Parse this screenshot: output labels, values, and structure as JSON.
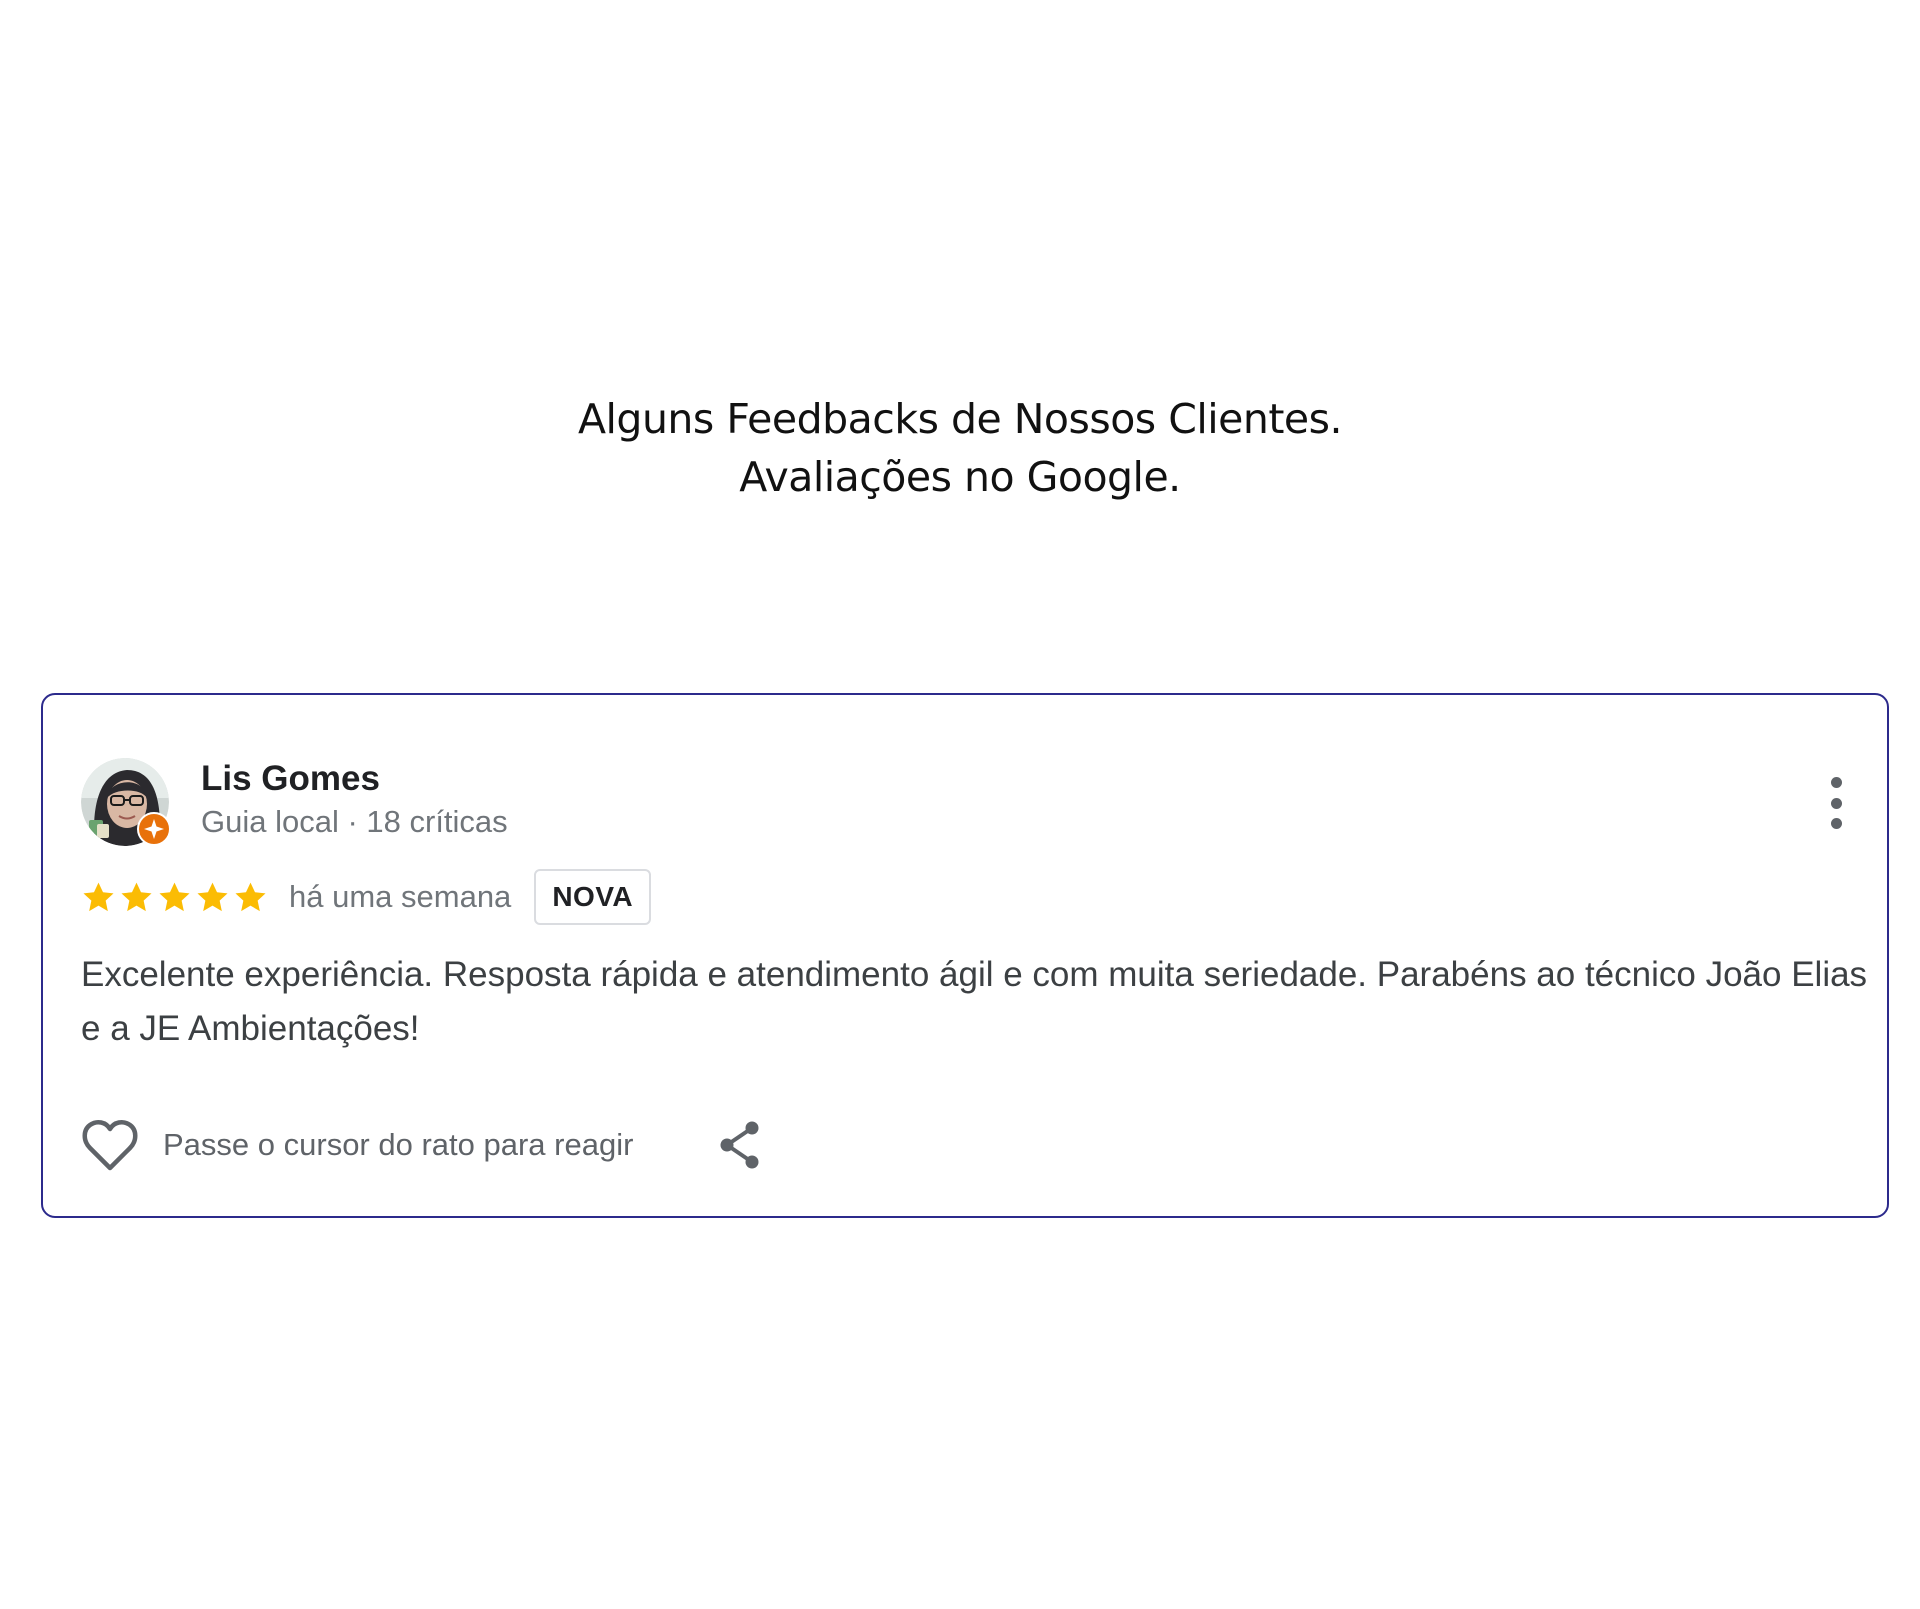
{
  "header": {
    "title_line1": "Alguns Feedbacks de Nossos Clientes.",
    "title_line2": "Avaliações no Google."
  },
  "review": {
    "reviewer_name": "Lis Gomes",
    "reviewer_meta": "Guia local · 18 críticas",
    "rating": 5,
    "rating_max": 5,
    "date": "há uma semana",
    "badge": "NOVA",
    "text": "Excelente experiência. Resposta rápida e atendimento ágil e com muita seriedade. Parabéns ao técnico João Elias e a JE Ambientações!",
    "react_hint": "Passe o cursor do rato para reagir",
    "icons": {
      "avatar": "avatar",
      "local_guide_badge": "local-guide-badge-icon",
      "more": "more-vert-icon",
      "star": "star-icon",
      "like": "heart-outline-icon",
      "share": "share-icon"
    }
  },
  "colors": {
    "card_border": "#2c2a8c",
    "star": "#fbbc04",
    "guide_badge": "#e8710a",
    "heading_text": "#111111",
    "body_text": "#3c4043",
    "muted_text": "#70757a"
  }
}
